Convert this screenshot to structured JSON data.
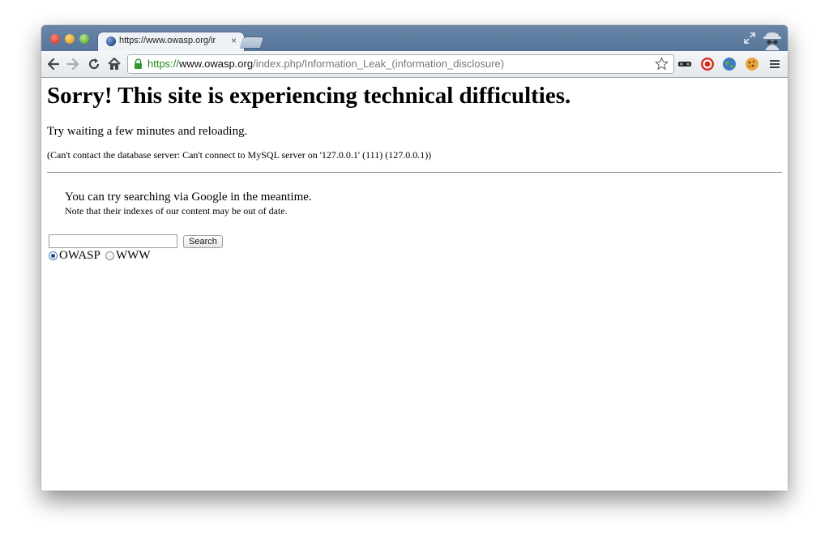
{
  "browser": {
    "tab_title": "https://www.owasp.org/ir",
    "tab_close": "×",
    "url": {
      "scheme": "https://",
      "host": "www.owasp.org",
      "path": "/index.php/Information_Leak_(information_disclosure)"
    },
    "icons": [
      "back-icon",
      "forward-icon",
      "reload-icon",
      "home-icon",
      "lock-icon",
      "star-icon",
      "incognito-icon",
      "fullscreen-icon",
      "menu-icon"
    ]
  },
  "page": {
    "heading": "Sorry! This site is experiencing technical difficulties.",
    "retry_text": "Try waiting a few minutes and reloading.",
    "db_error": "(Can't contact the database server: Can't connect to MySQL server on '127.0.0.1' (111) (127.0.0.1))",
    "google_tip": "You can try searching via Google in the meantime.",
    "google_note": "Note that their indexes of our content may be out of date.",
    "search": {
      "value": "",
      "button_label": "Search",
      "options": [
        {
          "label": "OWASP",
          "selected": true
        },
        {
          "label": "WWW",
          "selected": false
        }
      ]
    }
  },
  "colors": {
    "titlebar": "#56759a",
    "secure_scheme": "#1e8a1e"
  }
}
